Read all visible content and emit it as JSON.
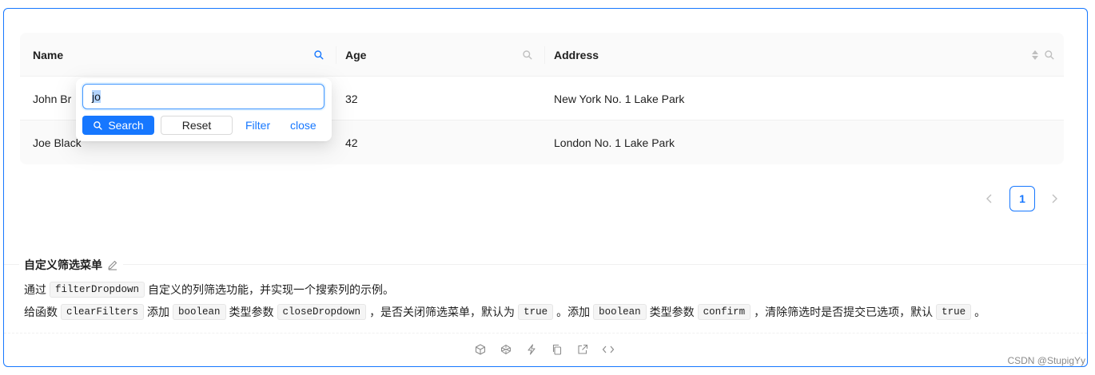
{
  "table": {
    "columns": [
      {
        "title": "Name",
        "filter_icon": "search-icon",
        "filter_active": true
      },
      {
        "title": "Age",
        "filter_icon": "search-icon",
        "filter_active": false
      },
      {
        "title": "Address",
        "filter_icon": "search-icon",
        "sorter_icon": "caret-up-down-icon",
        "filter_active": false
      }
    ],
    "rows": [
      {
        "name": "John Br",
        "age": "32",
        "address": "New York No. 1 Lake Park"
      },
      {
        "name": "Joe Black",
        "age": "42",
        "address": "London No. 1 Lake Park"
      }
    ]
  },
  "filter_dropdown": {
    "input_value": "jo",
    "search_label": "Search",
    "reset_label": "Reset",
    "filter_label": "Filter",
    "close_label": "close"
  },
  "pagination": {
    "current_page": "1",
    "prev_icon": "chevron-left-icon",
    "next_icon": "chevron-right-icon"
  },
  "description": {
    "title": "自定义筛选菜单",
    "line1": {
      "t1": "通过",
      "code1": "filterDropdown",
      "t2": "自定义的列筛选功能，并实现一个搜索列的示例。"
    },
    "line2": {
      "t1": "给函数",
      "code1": "clearFilters",
      "t2": "添加",
      "code2": "boolean",
      "t3": "类型参数",
      "code3": "closeDropdown",
      "t4": "，是否关闭筛选菜单，默认为",
      "code4": "true",
      "t5": "。添加",
      "code5": "boolean",
      "t6": "类型参数",
      "code6": "confirm",
      "t7": "，清除筛选时是否提交已选项，默认",
      "code7": "true",
      "t8": "。"
    }
  },
  "actions": [
    "codesandbox-icon",
    "codepen-icon",
    "stackblitz-icon",
    "copy-icon",
    "open-external-icon",
    "code-icon"
  ],
  "watermark": "CSDN @StupigYy",
  "colors": {
    "primary": "#1677ff",
    "header_bg": "#fafafa",
    "border": "#f0f0f0"
  }
}
